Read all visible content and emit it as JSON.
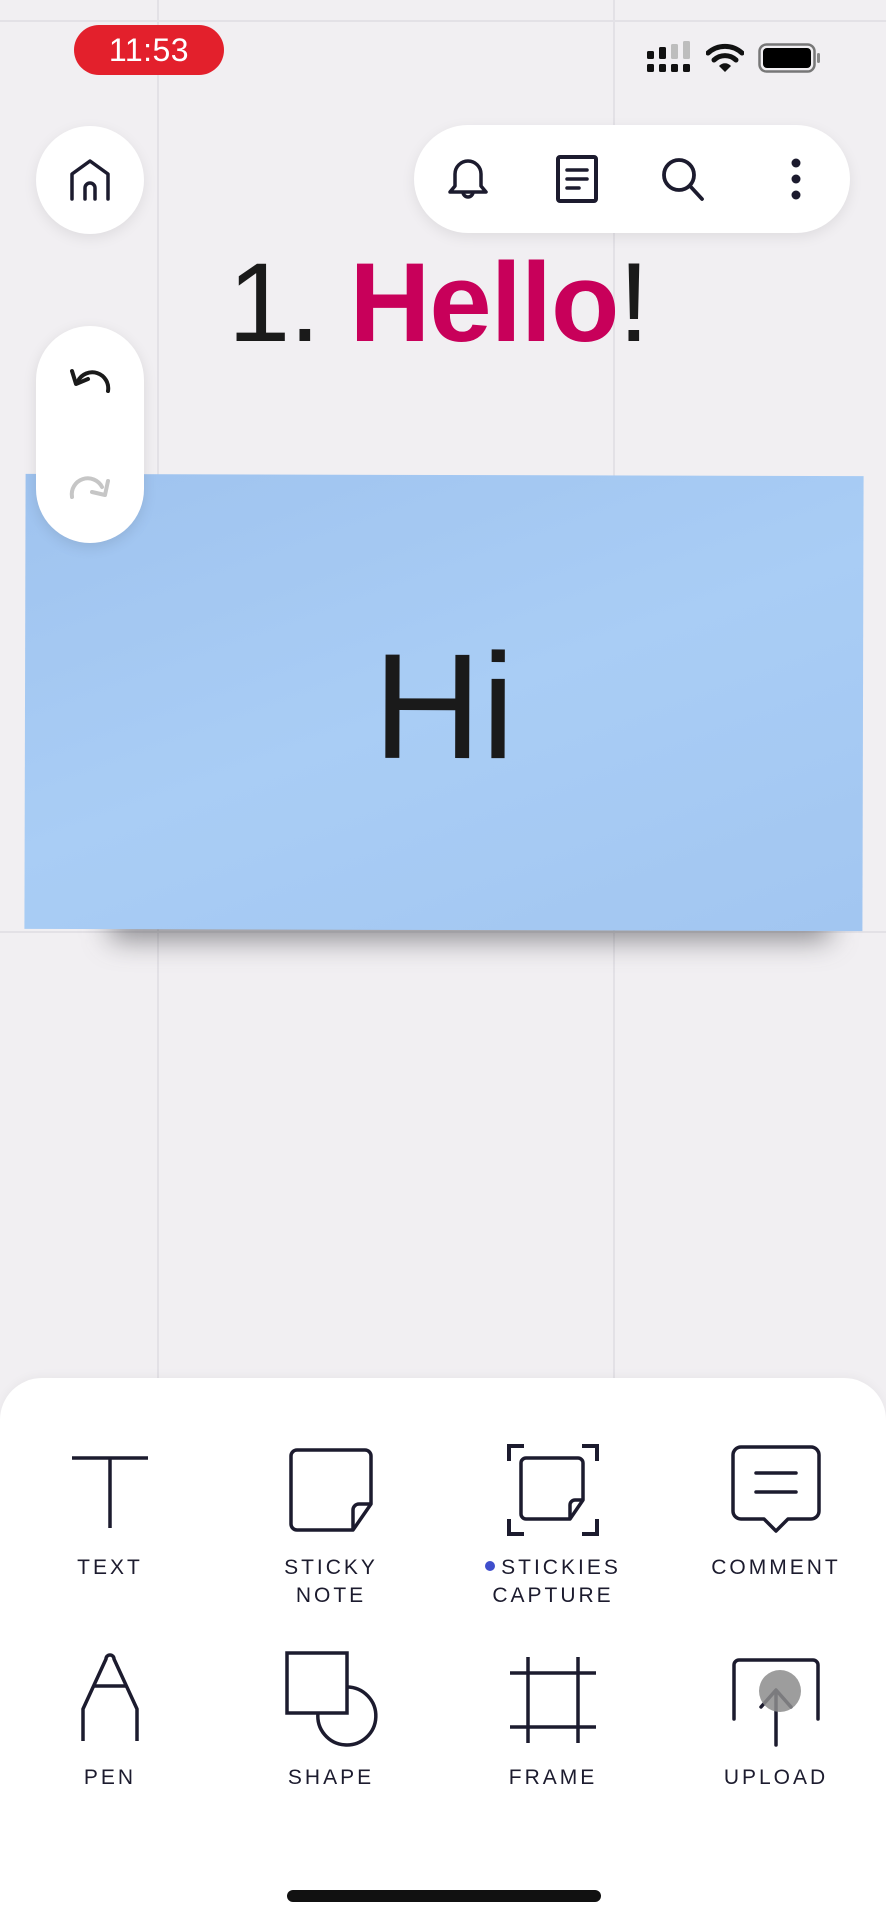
{
  "status_bar": {
    "time": "11:53",
    "icons": [
      "signal-icon",
      "wifi-icon",
      "battery-icon"
    ]
  },
  "top_bar": {
    "home_icon": "home-icon",
    "toolbar_icons": [
      "bell-icon",
      "document-icon",
      "search-icon",
      "more-vertical-icon"
    ]
  },
  "history": {
    "undo_icon": "undo-icon",
    "redo_icon": "redo-icon",
    "redo_enabled": false
  },
  "canvas": {
    "heading": {
      "number": "1. ",
      "word": "Hello",
      "punct": "!",
      "word_color": "#C8005A"
    },
    "sticky_note": {
      "text": "Hi",
      "color": "#A5C8F3"
    }
  },
  "tools": [
    {
      "label": "TEXT",
      "icon": "text-icon"
    },
    {
      "label": "STICKY\nNOTE",
      "icon": "sticky-note-icon"
    },
    {
      "label": "STICKIES\nCAPTURE",
      "icon": "stickies-capture-icon",
      "has_new_dot": true
    },
    {
      "label": "COMMENT",
      "icon": "comment-icon"
    },
    {
      "label": "PEN",
      "icon": "pen-icon"
    },
    {
      "label": "SHAPE",
      "icon": "shape-icon"
    },
    {
      "label": "FRAME",
      "icon": "frame-icon"
    },
    {
      "label": "UPLOAD",
      "icon": "upload-icon"
    }
  ],
  "colors": {
    "accent_dot": "#3F4ECC",
    "time_pill": "#E3202C",
    "icon_stroke": "#1C1B2E"
  }
}
